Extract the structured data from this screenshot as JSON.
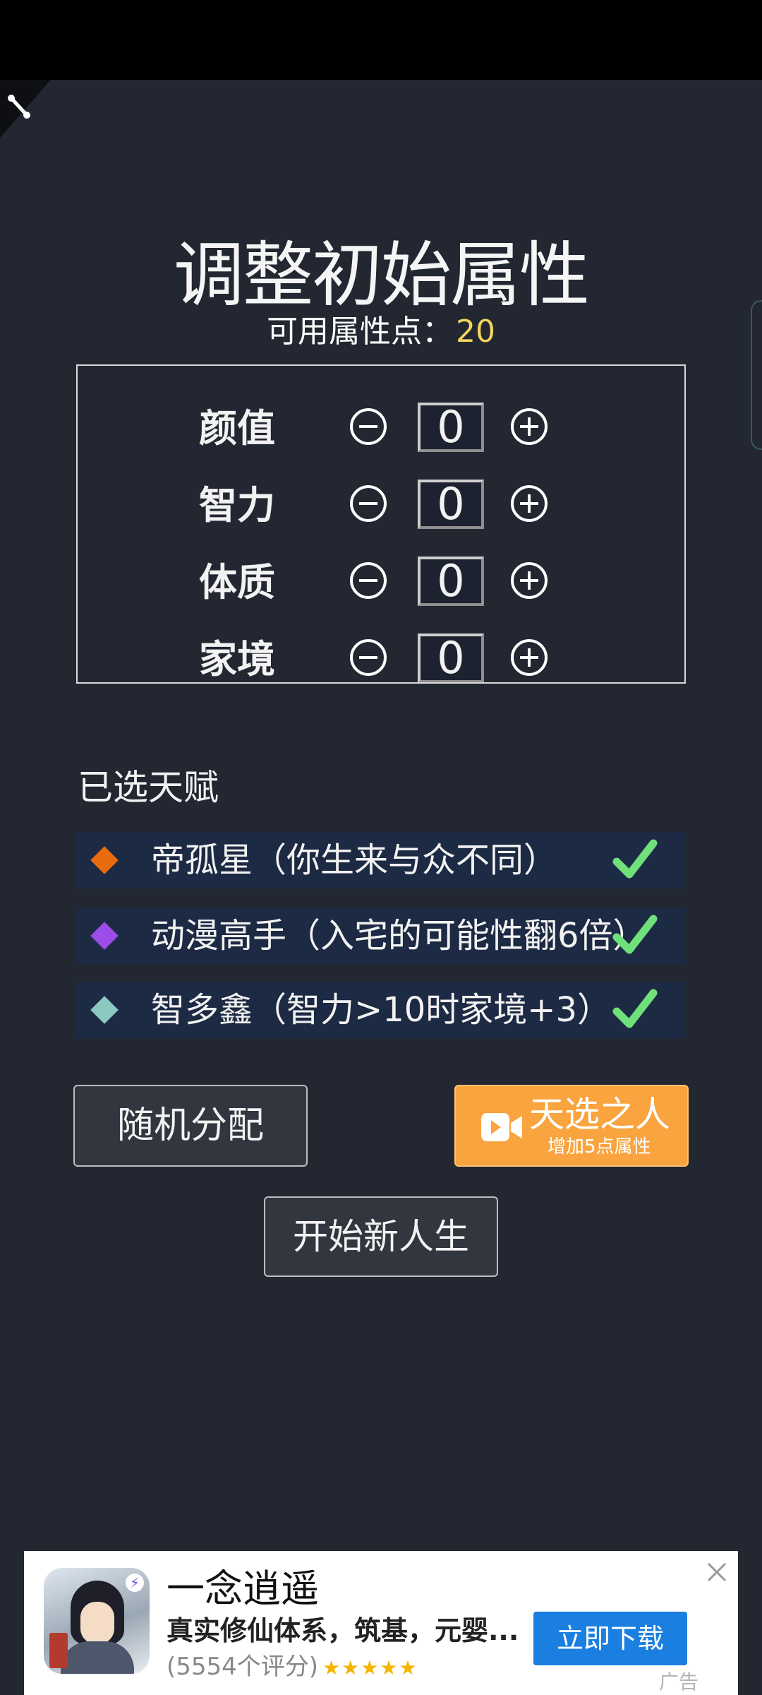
{
  "screen": {
    "title": "调整初始属性",
    "points_label": "可用属性点：",
    "points_value": "20"
  },
  "attributes": [
    {
      "label": "颜值",
      "value": "0"
    },
    {
      "label": "智力",
      "value": "0"
    },
    {
      "label": "体质",
      "value": "0"
    },
    {
      "label": "家境",
      "value": "0"
    }
  ],
  "talents": {
    "heading": "已选天赋",
    "items": [
      {
        "label": "帝孤星（你生来与众不同）",
        "color": "#e86b0c"
      },
      {
        "label": "动漫高手（入宅的可能性翻6倍）",
        "color": "#9b4de8"
      },
      {
        "label": "智多鑫（智力>10时家境+3）",
        "color": "#8cc9c0"
      }
    ]
  },
  "buttons": {
    "random": "随机分配",
    "chosen_title": "天选之人",
    "chosen_sub": "增加5点属性",
    "start": "开始新人生"
  },
  "ad": {
    "title": "一念逍遥",
    "description": "真实修仙体系，筑基，元婴...",
    "rating": "(5554个评分)",
    "stars": "★★★★★",
    "download": "立即下载",
    "label": "广告"
  },
  "icons": {
    "minus": "minus-circle-icon",
    "plus": "plus-circle-icon",
    "check": "check-icon",
    "video": "video-camera-icon",
    "close": "close-icon"
  },
  "colors": {
    "background": "#222731",
    "accent_yellow": "#f4d35e",
    "talent_row": "#1d2a44",
    "orange_button": "#f9a43f",
    "check_green": "#6fe07a",
    "download_blue": "#1a7fe0"
  }
}
